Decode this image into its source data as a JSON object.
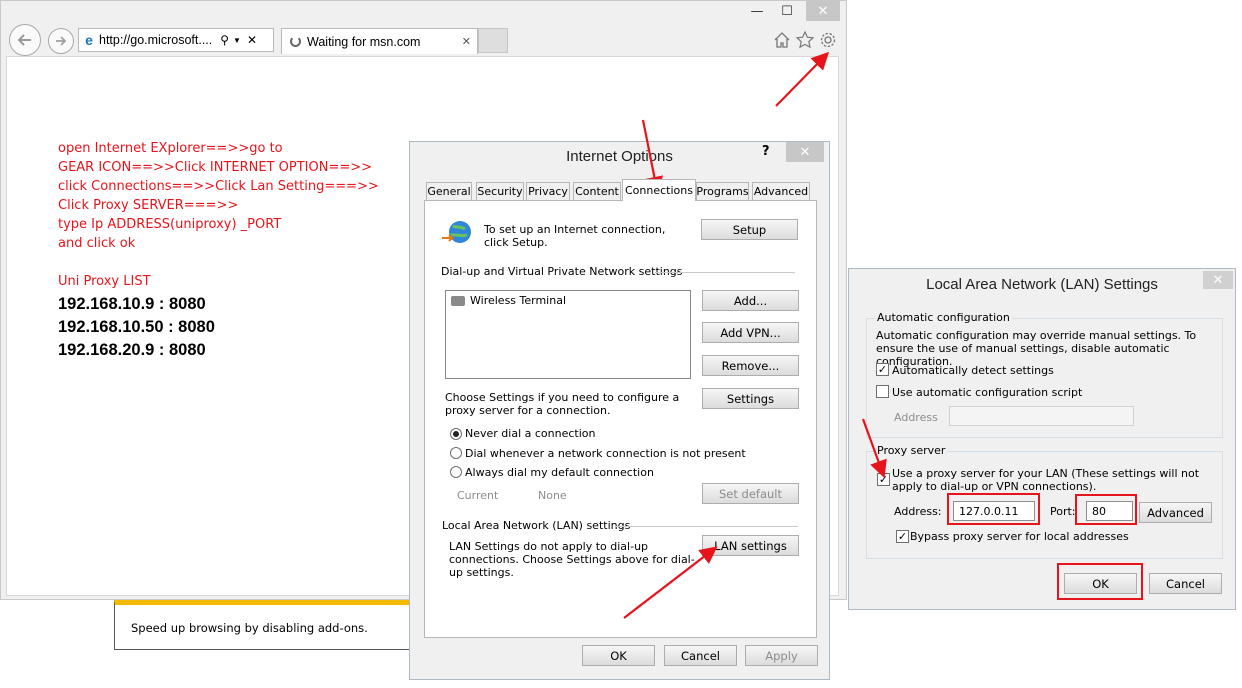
{
  "browser": {
    "address": "http://go.microsoft....",
    "tab_title": "Waiting for msn.com",
    "minimize": "—",
    "maximize": "☐",
    "close": "✕"
  },
  "instructions": [
    "open Internet EXplorer==>>go to",
    "GEAR ICON==>>Click INTERNET OPTION==>>",
    "click Connections==>>Click Lan Setting===>>",
    "Click Proxy SERVER===>>",
    "type Ip ADDRESS(uniproxy) _PORT",
    "and click ok"
  ],
  "proxy_list": {
    "title": "Uni Proxy LIST",
    "entries": [
      "192.168.10.9 : 8080",
      "192.168.10.50 : 8080",
      "192.168.20.9 : 8080"
    ]
  },
  "notification": "Speed up browsing by disabling add-ons.",
  "internet_options": {
    "title": "Internet Options",
    "help": "?",
    "tabs": [
      "General",
      "Security",
      "Privacy",
      "Content",
      "Connections",
      "Programs",
      "Advanced"
    ],
    "selected_tab": "Connections",
    "setup_text": "To set up an Internet connection, click Setup.",
    "setup_button": "Setup",
    "dialup_header": "Dial-up and Virtual Private Network settings",
    "connections_list": [
      "Wireless Terminal"
    ],
    "add_button": "Add...",
    "add_vpn_button": "Add VPN...",
    "remove_button": "Remove...",
    "choose_text": "Choose Settings if you need to configure a proxy server for a connection.",
    "settings_button": "Settings",
    "radio_options": [
      "Never dial a connection",
      "Dial whenever a network connection is not present",
      "Always dial my default connection"
    ],
    "radio_selected": 0,
    "current_label": "Current",
    "current_value": "None",
    "set_default_button": "Set default",
    "lan_header": "Local Area Network (LAN) settings",
    "lan_text": "LAN Settings do not apply to dial-up connections. Choose Settings above for dial-up settings.",
    "lan_button": "LAN settings",
    "ok": "OK",
    "cancel": "Cancel",
    "apply": "Apply"
  },
  "lan_settings": {
    "title": "Local Area Network (LAN) Settings",
    "auto_header": "Automatic configuration",
    "auto_text": "Automatic configuration may override manual settings.  To ensure the use of manual settings, disable automatic configuration.",
    "auto_detect": "Automatically detect settings",
    "auto_detect_checked": true,
    "use_script": "Use automatic configuration script",
    "use_script_checked": false,
    "script_address_label": "Address",
    "proxy_header": "Proxy server",
    "use_proxy": "Use a proxy server for your LAN (These settings will not apply to dial-up or VPN connections).",
    "use_proxy_checked": true,
    "address_label": "Address:",
    "address_value": "127.0.0.11",
    "port_label": "Port:",
    "port_value": "80",
    "advanced_button": "Advanced",
    "bypass": "Bypass proxy server for local addresses",
    "bypass_checked": true,
    "ok": "OK",
    "cancel": "Cancel"
  },
  "colors": {
    "annotation_red": "#e8141b",
    "notification_bar": "#f3b800",
    "proxy_list_text": "#000000"
  }
}
